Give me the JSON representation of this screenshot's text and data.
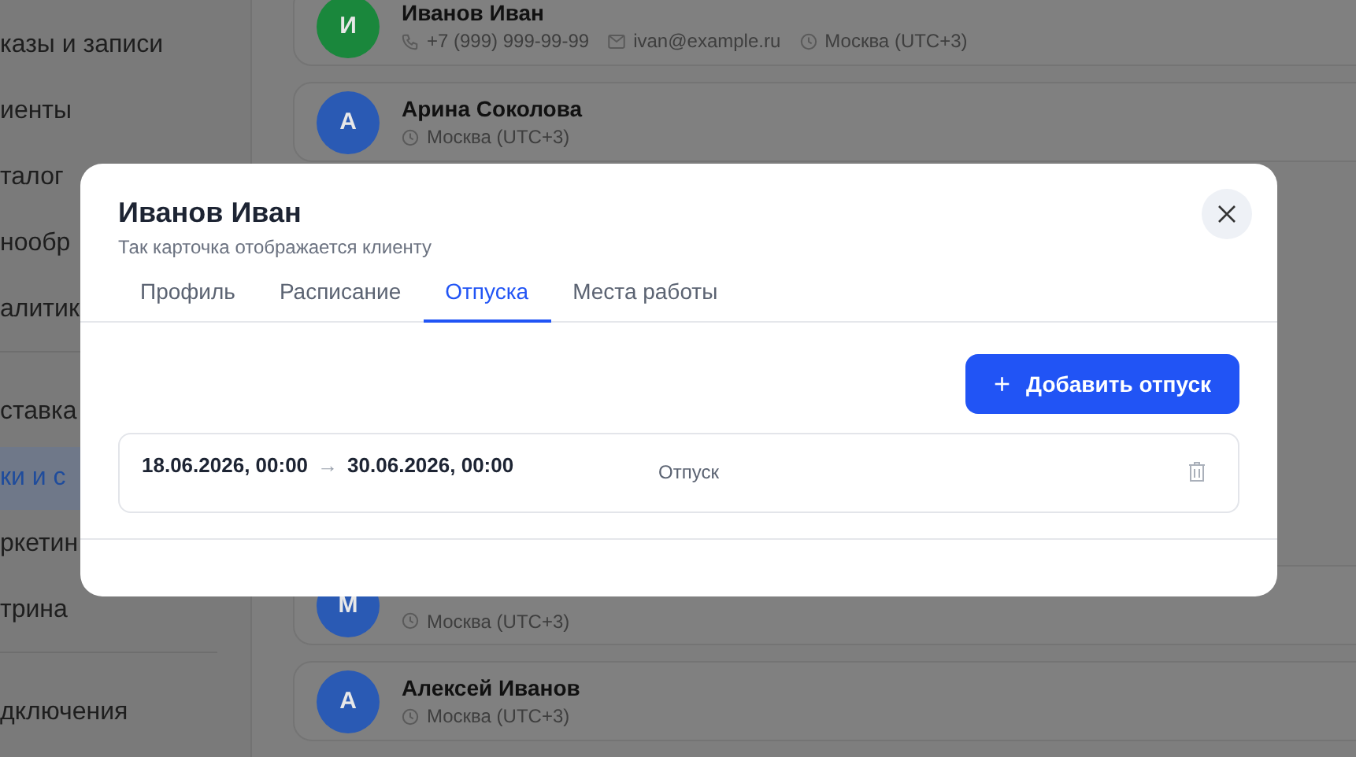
{
  "sidebar": {
    "groups": [
      {
        "items": [
          {
            "label": "казы и записи",
            "selected": false
          },
          {
            "label": "иенты",
            "selected": false
          },
          {
            "label": "талог",
            "selected": false
          },
          {
            "label": "нообр",
            "selected": false
          },
          {
            "label": "алитик",
            "selected": false
          }
        ]
      },
      {
        "items": [
          {
            "label": "ставка",
            "selected": false
          },
          {
            "label": "ки и с",
            "selected": true
          },
          {
            "label": "ркетин",
            "selected": false
          },
          {
            "label": "трина",
            "selected": false
          }
        ]
      },
      {
        "items": [
          {
            "label": "дключения",
            "selected": false
          }
        ]
      }
    ]
  },
  "clients": [
    {
      "initial": "И",
      "color": "#1a873c",
      "name": "Иванов Иван",
      "phone": "+7 (999) 999-99-99",
      "email": "ivan@example.ru",
      "timezone": "Москва (UTC+3)"
    },
    {
      "initial": "А",
      "color": "#2a5ab4",
      "name": "Арина Соколова",
      "timezone": "Москва (UTC+3)"
    },
    {
      "initial": "М",
      "color": "#2a5ab4",
      "timezone": "Москва (UTC+3)"
    },
    {
      "initial": "А",
      "color": "#2a5ab4",
      "name": "Алексей Иванов",
      "timezone": "Москва (UTC+3)"
    }
  ],
  "modal": {
    "title": "Иванов Иван",
    "subtitle": "Так карточка отображается клиенту",
    "tabs": [
      {
        "label": "Профиль",
        "selected": false
      },
      {
        "label": "Расписание",
        "selected": false
      },
      {
        "label": "Отпуска",
        "selected": true
      },
      {
        "label": "Места работы",
        "selected": false
      }
    ],
    "add_button": {
      "icon": "+",
      "label": "Добавить отпуск"
    },
    "vacations": [
      {
        "start": "18.06.2026, 00:00",
        "arrow": "→",
        "end": "30.06.2026, 00:00",
        "type": "Отпуск"
      }
    ]
  }
}
